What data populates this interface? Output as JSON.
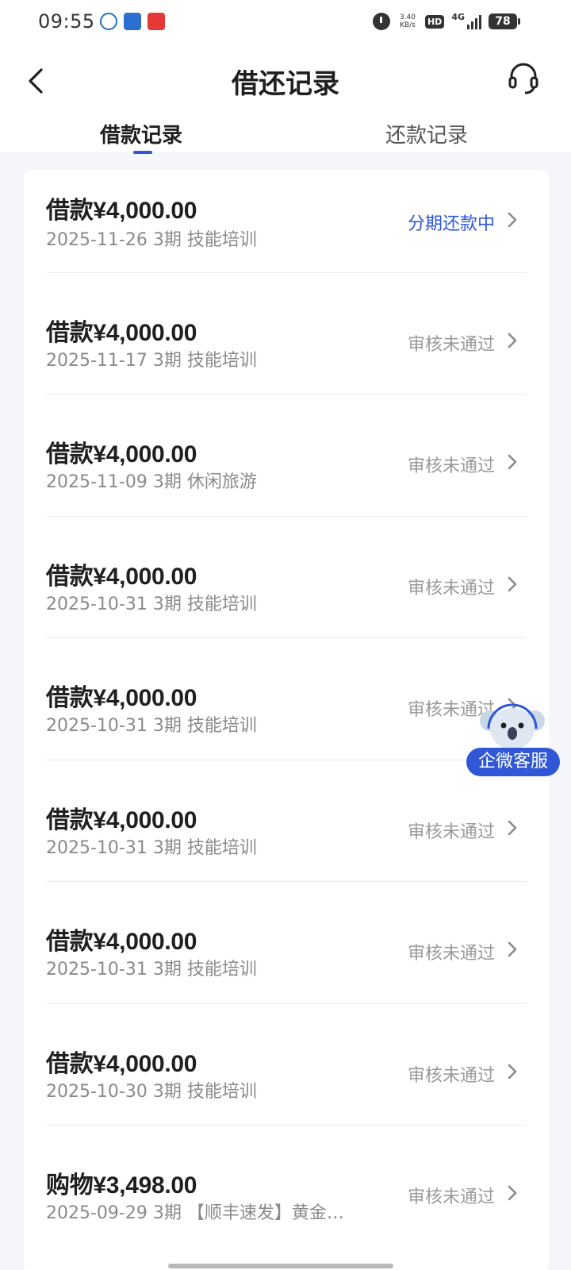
{
  "status_bar": {
    "time": "09:55",
    "net_speed_value": "3.40",
    "net_speed_unit": "KB/s",
    "hd": "HD",
    "network": "4G",
    "battery": "78"
  },
  "header": {
    "title": "借还记录",
    "tabs": [
      {
        "label": "借款记录",
        "selected": true
      },
      {
        "label": "还款记录",
        "selected": false
      }
    ]
  },
  "records": [
    {
      "title": "借款¥4,000.00",
      "meta": "2025-11-26 3期  技能培训",
      "status": "分期还款中"
    },
    {
      "title": "借款¥4,000.00",
      "meta": "2025-11-17 3期  技能培训",
      "status": "审核未通过"
    },
    {
      "title": "借款¥4,000.00",
      "meta": "2025-11-09 3期  休闲旅游",
      "status": "审核未通过"
    },
    {
      "title": "借款¥4,000.00",
      "meta": "2025-10-31 3期  技能培训",
      "status": "审核未通过"
    },
    {
      "title": "借款¥4,000.00",
      "meta": "2025-10-31 3期  技能培训",
      "status": "审核未通过"
    },
    {
      "title": "借款¥4,000.00",
      "meta": "2025-10-31 3期  技能培训",
      "status": "审核未通过"
    },
    {
      "title": "借款¥4,000.00",
      "meta": "2025-10-31 3期  技能培训",
      "status": "审核未通过"
    },
    {
      "title": "借款¥4,000.00",
      "meta": "2025-10-30 3期  技能培训",
      "status": "审核未通过"
    },
    {
      "title": "购物¥3,498.00",
      "meta": "2025-09-29 3期  【顺丰速发】黄金…",
      "status": "审核未通过"
    }
  ],
  "floating_support": {
    "label": "企微客服"
  },
  "colors": {
    "accent": "#2f57d6",
    "muted": "#9a9a9a",
    "background": "#f4f6fb"
  }
}
